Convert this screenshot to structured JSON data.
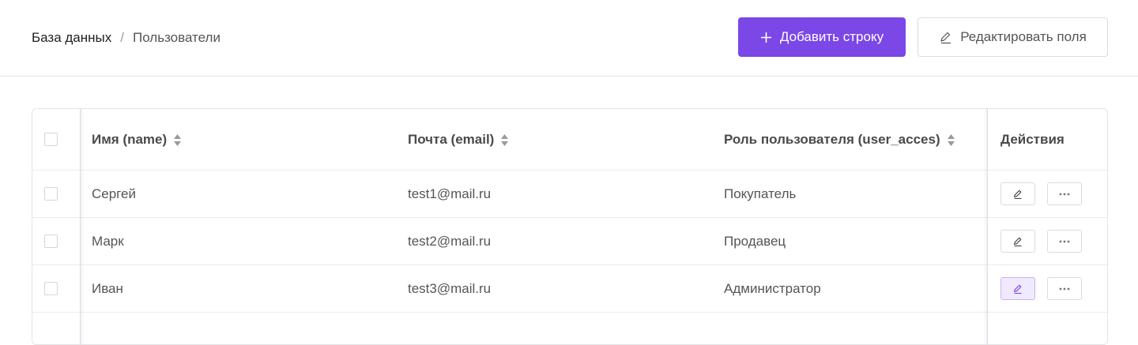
{
  "breadcrumb": {
    "root": "База данных",
    "separator": "/",
    "current": "Пользователи"
  },
  "toolbar": {
    "add_row_label": "Добавить строку",
    "add_row_icon": "plus-icon",
    "edit_fields_label": "Редактировать поля",
    "edit_fields_icon": "pencil-icon"
  },
  "colors": {
    "accent": "#7b47e6",
    "active_action_bg": "#f1eafe"
  },
  "table": {
    "columns": [
      {
        "label": "Имя (name)",
        "sortable": true
      },
      {
        "label": "Почта (email)",
        "sortable": true
      },
      {
        "label": "Роль пользователя (user_acces)",
        "sortable": true
      },
      {
        "label": "Действия",
        "sortable": false
      }
    ],
    "rows": [
      {
        "name": "Сергей",
        "email": "test1@mail.ru",
        "role": "Покупатель",
        "edit_active": false
      },
      {
        "name": "Марк",
        "email": "test2@mail.ru",
        "role": "Продавец",
        "edit_active": false
      },
      {
        "name": "Иван",
        "email": "test3@mail.ru",
        "role": "Администратор",
        "edit_active": true
      }
    ]
  }
}
